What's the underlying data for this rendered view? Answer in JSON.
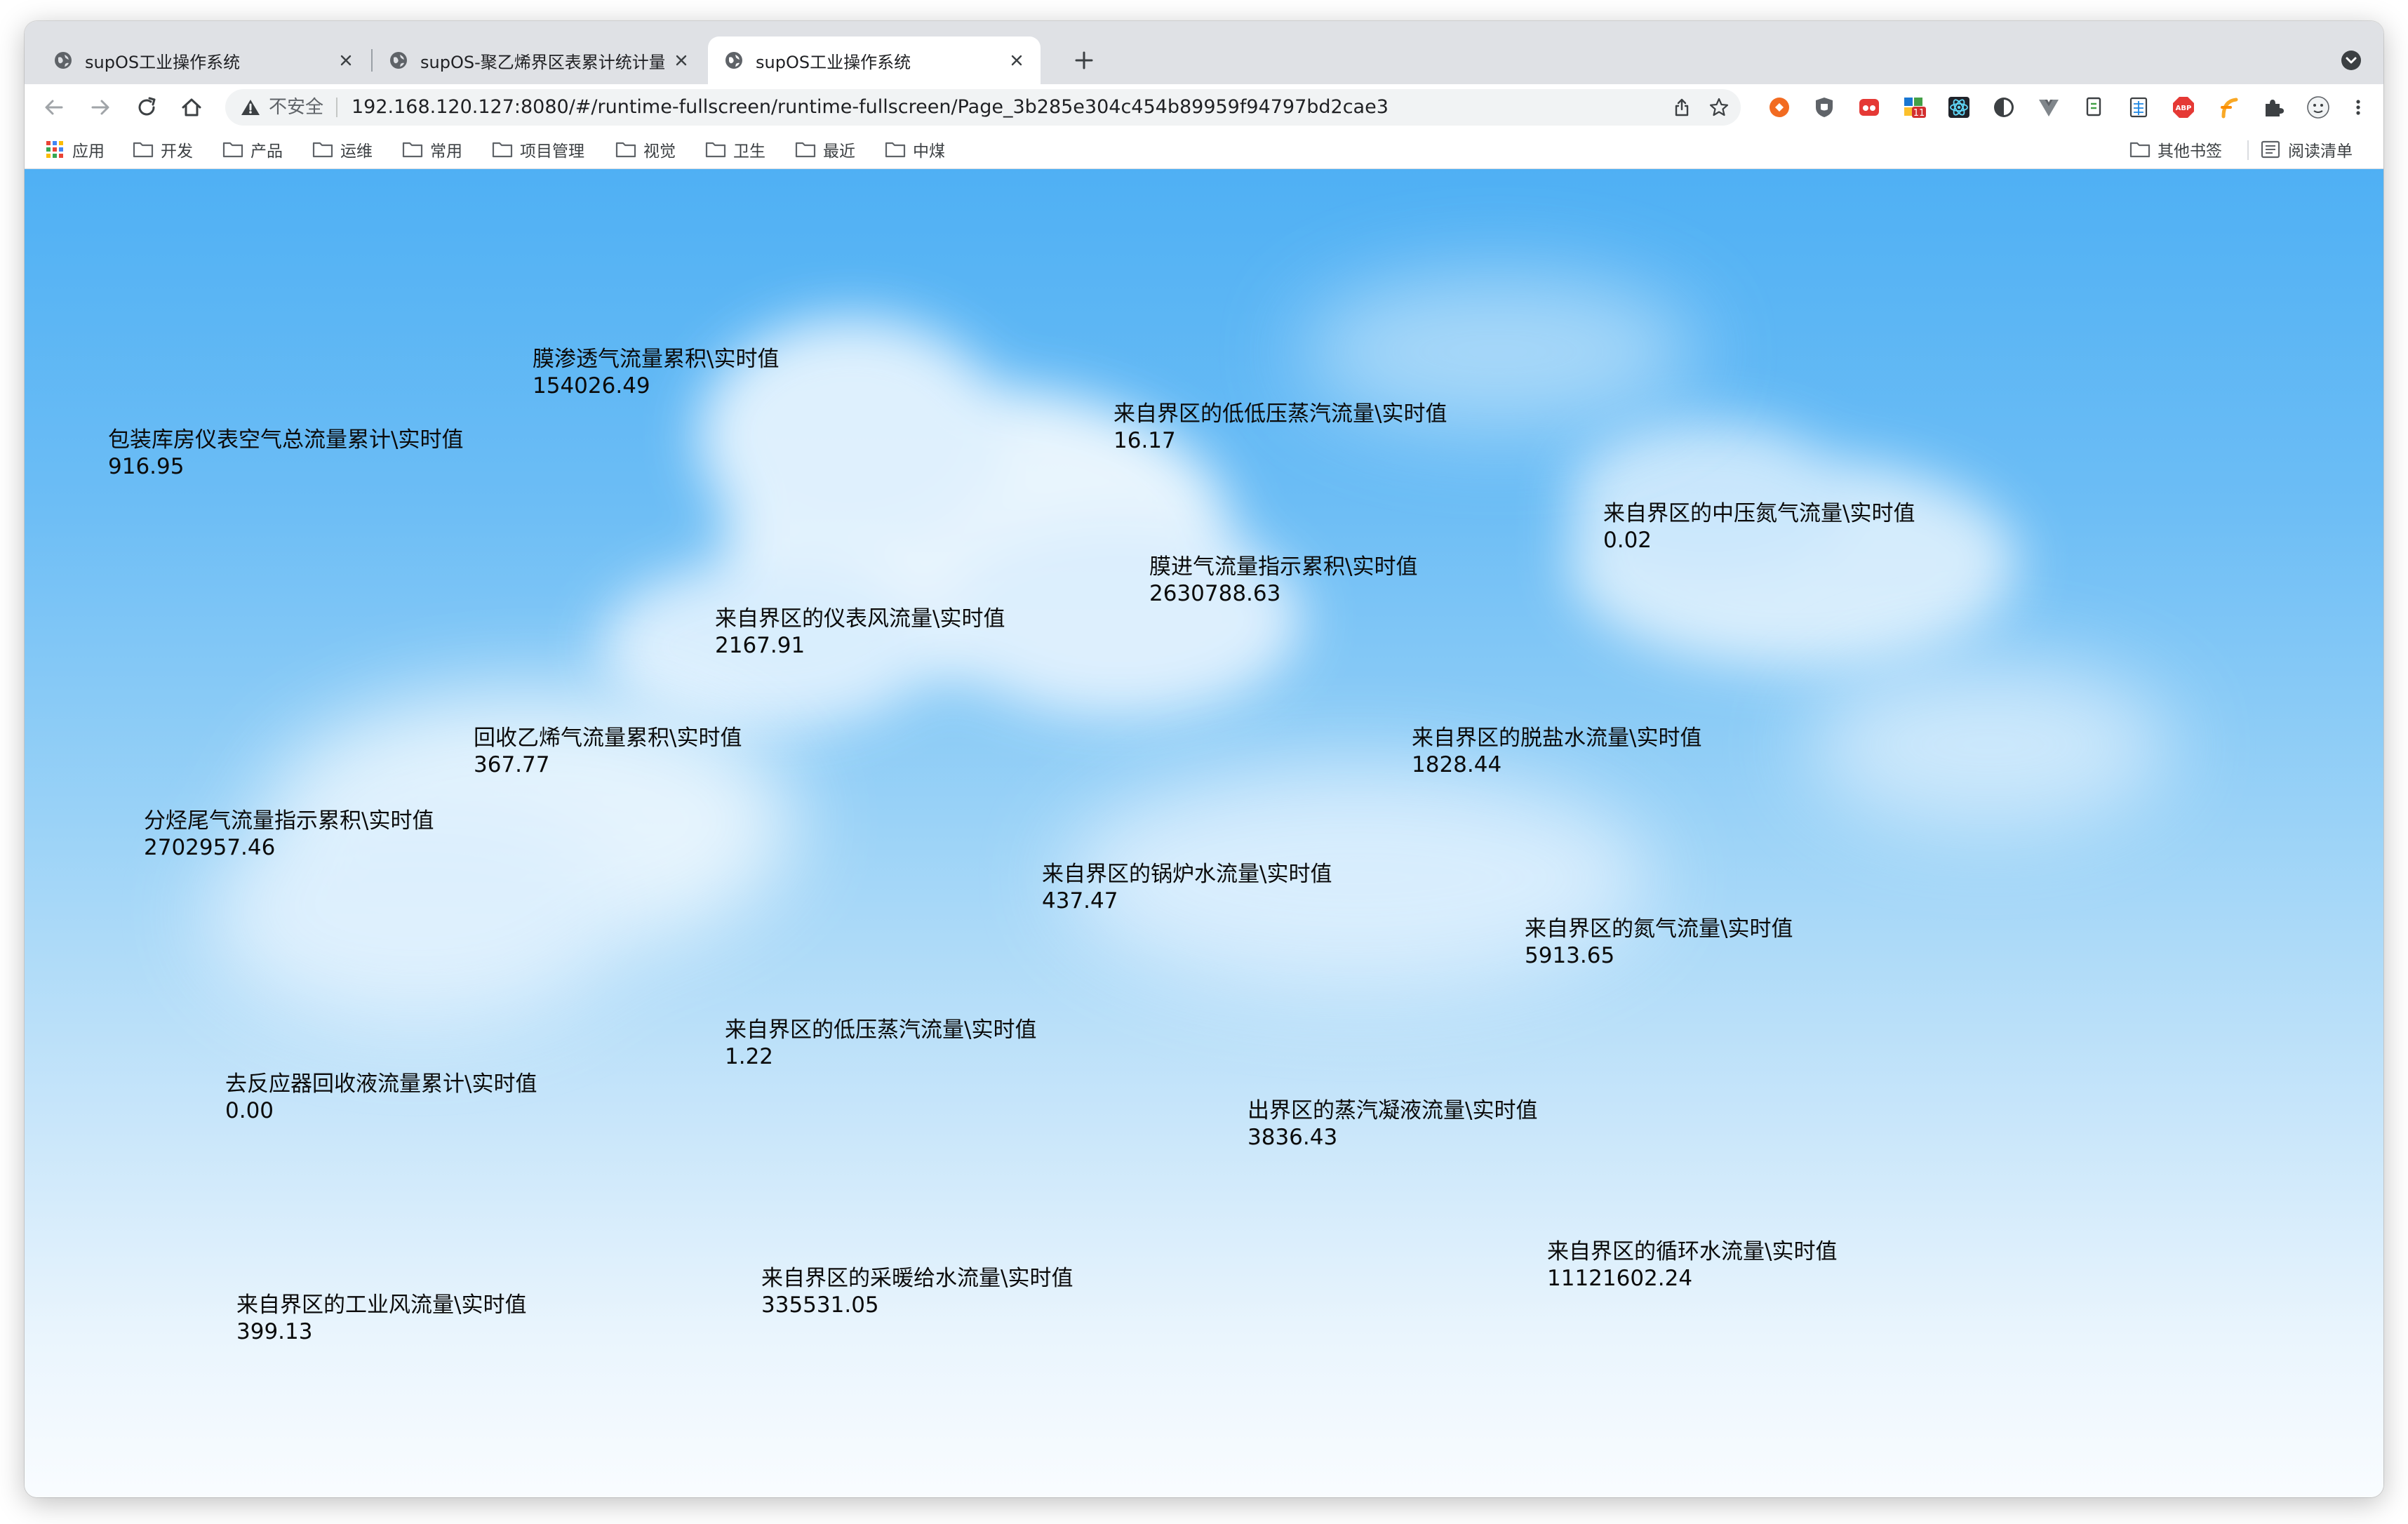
{
  "browser": {
    "tabs": [
      {
        "title": "supOS工业操作系统",
        "active": false
      },
      {
        "title": "supOS-聚乙烯界区表累计统计量",
        "active": false
      },
      {
        "title": "supOS工业操作系统",
        "active": true
      }
    ],
    "new_tab_label": "+",
    "security_label": "不安全",
    "url": "192.168.120.127:8080/#/runtime-fullscreen/runtime-fullscreen/Page_3b285e304c454b89959f94797bd2cae3",
    "extension_badge": "11",
    "bookmarks": [
      {
        "label": "应用",
        "icon": "apps-grid-icon"
      },
      {
        "label": "开发",
        "icon": "folder-icon"
      },
      {
        "label": "产品",
        "icon": "folder-icon"
      },
      {
        "label": "运维",
        "icon": "folder-icon"
      },
      {
        "label": "常用",
        "icon": "folder-icon"
      },
      {
        "label": "项目管理",
        "icon": "folder-icon"
      },
      {
        "label": "视觉",
        "icon": "folder-icon"
      },
      {
        "label": "卫生",
        "icon": "folder-icon"
      },
      {
        "label": "最近",
        "icon": "folder-icon"
      },
      {
        "label": "中煤",
        "icon": "folder-icon"
      }
    ],
    "other_bookmarks": "其他书签",
    "reading_list": "阅读清单"
  },
  "metrics": [
    {
      "label": "膜渗透气流量累积\\实时值",
      "value": "154026.49"
    },
    {
      "label": "包装库房仪表空气总流量累计\\实时值",
      "value": "916.95"
    },
    {
      "label": "来自界区的低低压蒸汽流量\\实时值",
      "value": "16.17"
    },
    {
      "label": "来自界区的中压氮气流量\\实时值",
      "value": "0.02"
    },
    {
      "label": "膜进气流量指示累积\\实时值",
      "value": "2630788.63"
    },
    {
      "label": "来自界区的仪表风流量\\实时值",
      "value": "2167.91"
    },
    {
      "label": "回收乙烯气流量累积\\实时值",
      "value": "367.77"
    },
    {
      "label": "来自界区的脱盐水流量\\实时值",
      "value": "1828.44"
    },
    {
      "label": "分烃尾气流量指示累积\\实时值",
      "value": "2702957.46"
    },
    {
      "label": "来自界区的锅炉水流量\\实时值",
      "value": "437.47"
    },
    {
      "label": "来自界区的氮气流量\\实时值",
      "value": "5913.65"
    },
    {
      "label": "来自界区的低压蒸汽流量\\实时值",
      "value": "1.22"
    },
    {
      "label": "去反应器回收液流量累计\\实时值",
      "value": "0.00"
    },
    {
      "label": "出界区的蒸汽凝液流量\\实时值",
      "value": "3836.43"
    },
    {
      "label": "来自界区的循环水流量\\实时值",
      "value": "11121602.24"
    },
    {
      "label": "来自界区的采暖给水流量\\实时值",
      "value": "335531.05"
    },
    {
      "label": "来自界区的工业风流量\\实时值",
      "value": "399.13"
    }
  ]
}
